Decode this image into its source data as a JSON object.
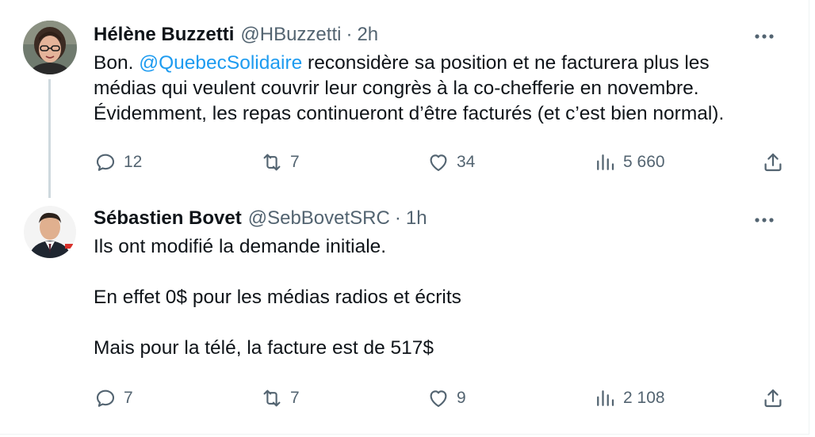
{
  "tweets": [
    {
      "author_name": "Hélène Buzzetti",
      "handle": "@HBuzzetti",
      "separator": "·",
      "time": "2h",
      "text_prefix": "Bon. ",
      "mention": "@QuebecSolidaire",
      "text_line1_rest": " reconsidère sa position et ne facturera plus les",
      "text_line2": "médias qui veulent couvrir leur congrès à la co-chefferie en novembre.",
      "text_line3": "Évidemment, les repas continueront d’être facturés (et c’est bien normal).",
      "replies": "12",
      "retweets": "7",
      "likes": "34",
      "views": "5 660"
    },
    {
      "author_name": "Sébastien Bovet",
      "handle": "@SebBovetSRC",
      "separator": "·",
      "time": "1h",
      "para1": "Ils ont modifié la demande initiale.",
      "para2": "En effet 0$ pour les médias radios et écrits",
      "para3": "Mais pour la télé, la facture est de 517$",
      "replies": "7",
      "retweets": "7",
      "likes": "9",
      "views": "2 108"
    }
  ],
  "icons": {
    "reply": "reply-icon",
    "retweet": "retweet-icon",
    "like": "like-icon",
    "views": "views-icon",
    "share": "share-icon",
    "more": "more-icon"
  },
  "colors": {
    "link": "#1d9bf0",
    "secondary_text": "#536471",
    "primary_text": "#0f1419",
    "thread_line": "#cfd9de"
  }
}
